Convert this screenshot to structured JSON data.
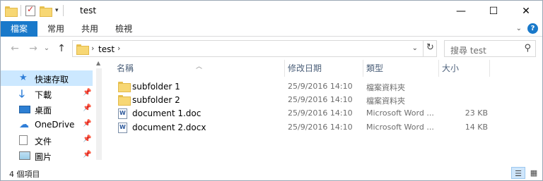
{
  "window": {
    "title": "test"
  },
  "window_controls": {
    "minimize": "—",
    "maximize": "☐",
    "close": "✕"
  },
  "ribbon": {
    "tabs": [
      {
        "label": "檔案"
      },
      {
        "label": "常用"
      },
      {
        "label": "共用"
      },
      {
        "label": "檢視"
      }
    ],
    "expand_glyph": "⌄",
    "help_glyph": "?"
  },
  "nav": {
    "back": "←",
    "forward": "→",
    "recent": "⌄",
    "up": "↑",
    "breadcrumb": [
      "test"
    ],
    "crumb_sep": "›",
    "refresh": "↻",
    "search_placeholder": "搜尋 test",
    "search_icon": "⚲"
  },
  "sidebar": {
    "items": [
      {
        "label": "快速存取",
        "icon": "star-icon",
        "pinned": false,
        "selected": true
      },
      {
        "label": "下載",
        "icon": "download-icon",
        "pinned": true
      },
      {
        "label": "桌面",
        "icon": "desktop-icon",
        "pinned": true
      },
      {
        "label": "OneDrive",
        "icon": "cloud-icon",
        "pinned": true
      },
      {
        "label": "文件",
        "icon": "document-icon",
        "pinned": true
      },
      {
        "label": "圖片",
        "icon": "picture-icon",
        "pinned": true
      }
    ]
  },
  "file_list": {
    "columns": {
      "name": "名稱",
      "date": "修改日期",
      "type": "類型",
      "size": "大小"
    },
    "rows": [
      {
        "name": "subfolder 1",
        "date": "25/9/2016 14:10",
        "type": "檔案資料夾",
        "size": "",
        "icon": "folder-icon"
      },
      {
        "name": "subfolder 2",
        "date": "25/9/2016 14:10",
        "type": "檔案資料夾",
        "size": "",
        "icon": "folder-icon"
      },
      {
        "name": "document 1.doc",
        "date": "25/9/2016 14:10",
        "type": "Microsoft Word ...",
        "size": "23 KB",
        "icon": "word-doc-icon"
      },
      {
        "name": "document 2.docx",
        "date": "25/9/2016 14:10",
        "type": "Microsoft Word ...",
        "size": "14 KB",
        "icon": "word-doc-icon"
      }
    ]
  },
  "status": {
    "item_count": "4 個項目"
  },
  "colors": {
    "accent": "#1979ca",
    "selection": "#cce8ff"
  }
}
